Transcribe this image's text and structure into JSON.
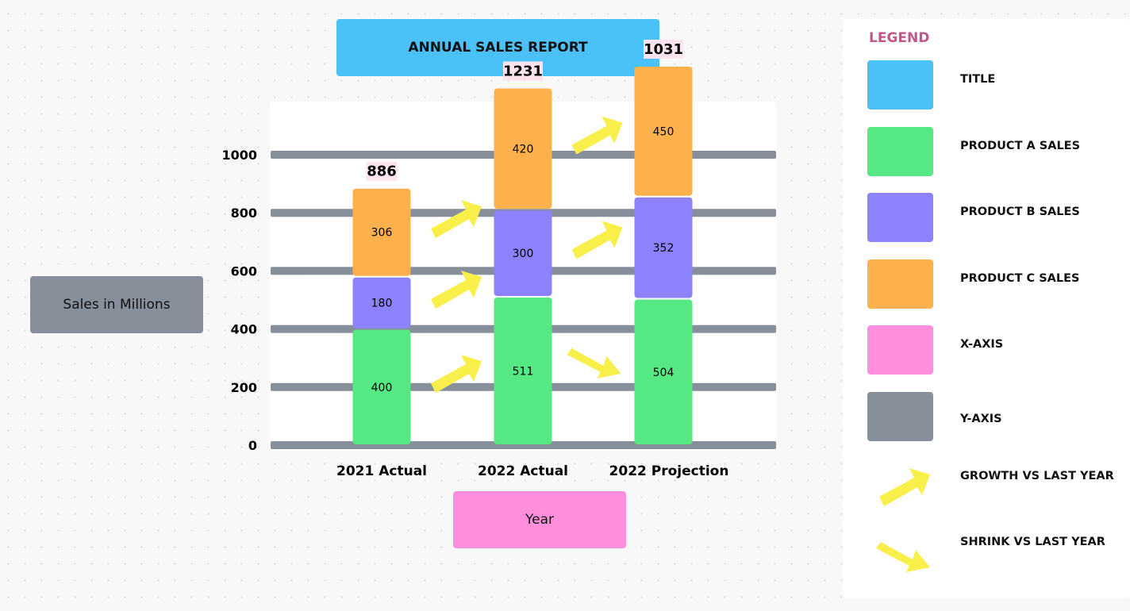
{
  "title": "ANNUAL SALES REPORT",
  "y_axis_box_label": "Sales in Millions",
  "x_axis_box_label": "Year",
  "colors": {
    "title": "#4ac1f7",
    "product_a": "#56e882",
    "product_b": "#8c82fc",
    "product_c": "#fdb14d",
    "x_axis": "#ff8fdd",
    "y_axis": "#878f9b",
    "arrow": "#f9ef4b",
    "total_label_bg": "#fde3ee",
    "legend_title": "#c2558a"
  },
  "chart_data": {
    "type": "bar",
    "stacked": true,
    "title": "ANNUAL SALES REPORT",
    "xlabel": "Year",
    "ylabel": "Sales in Millions",
    "ylim": [
      0,
      1000
    ],
    "yticks": [
      0,
      200,
      400,
      600,
      800,
      1000
    ],
    "grid": true,
    "legend_position": "right",
    "categories": [
      "2021 Actual",
      "2022 Actual",
      "2022 Projection"
    ],
    "series": [
      {
        "name": "PRODUCT A SALES",
        "values": [
          400,
          511,
          504
        ],
        "color": "#56e882"
      },
      {
        "name": "PRODUCT B SALES",
        "values": [
          180,
          300,
          352
        ],
        "color": "#8c82fc"
      },
      {
        "name": "PRODUCT C SALES",
        "values": [
          306,
          420,
          450
        ],
        "color": "#fdb14d"
      }
    ],
    "totals": [
      886,
      1231,
      1031
    ],
    "trend_arrows": [
      {
        "series": "PRODUCT A SALES",
        "from": "2021 Actual",
        "to": "2022 Actual",
        "direction": "growth"
      },
      {
        "series": "PRODUCT B SALES",
        "from": "2021 Actual",
        "to": "2022 Actual",
        "direction": "growth"
      },
      {
        "series": "PRODUCT C SALES",
        "from": "2021 Actual",
        "to": "2022 Actual",
        "direction": "growth"
      },
      {
        "series": "PRODUCT A SALES",
        "from": "2022 Actual",
        "to": "2022 Projection",
        "direction": "shrink"
      },
      {
        "series": "PRODUCT B SALES",
        "from": "2022 Actual",
        "to": "2022 Projection",
        "direction": "growth"
      },
      {
        "series": "PRODUCT C SALES",
        "from": "2022 Actual",
        "to": "2022 Projection",
        "direction": "growth"
      }
    ]
  },
  "legend": {
    "title": "LEGEND",
    "items": [
      {
        "label": "TITLE",
        "kind": "swatch",
        "color": "#4ac1f7"
      },
      {
        "label": "PRODUCT A SALES",
        "kind": "swatch",
        "color": "#56e882"
      },
      {
        "label": "PRODUCT B SALES",
        "kind": "swatch",
        "color": "#8c82fc"
      },
      {
        "label": "PRODUCT C SALES",
        "kind": "swatch",
        "color": "#fdb14d"
      },
      {
        "label": "X-AXIS",
        "kind": "swatch",
        "color": "#ff8fdd"
      },
      {
        "label": "Y-AXIS",
        "kind": "swatch",
        "color": "#878f9b"
      },
      {
        "label": "GROWTH VS LAST YEAR",
        "kind": "growth-arrow",
        "color": "#f9ef4b"
      },
      {
        "label": "SHRINK VS LAST YEAR",
        "kind": "shrink-arrow",
        "color": "#f9ef4b"
      }
    ]
  }
}
